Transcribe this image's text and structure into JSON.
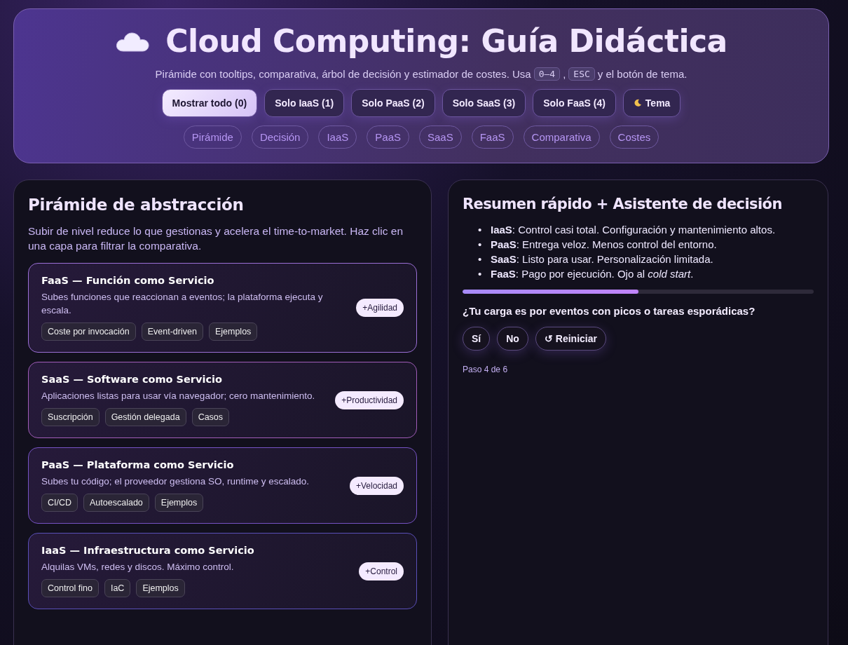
{
  "header": {
    "title": "Cloud Computing: Guía Didáctica",
    "subtitle_before": "Pirámide con tooltips, comparativa, árbol de decisión y estimador de costes. Usa",
    "keys": [
      "0–4",
      "ESC"
    ],
    "key_separator": ",",
    "subtitle_after": "y el botón de tema.",
    "filters": [
      {
        "label": "Mostrar todo (0)",
        "selected": true
      },
      {
        "label": "Solo IaaS (1)",
        "selected": false
      },
      {
        "label": "Solo PaaS (2)",
        "selected": false
      },
      {
        "label": "Solo SaaS (3)",
        "selected": false
      },
      {
        "label": "Solo FaaS (4)",
        "selected": false
      }
    ],
    "theme_button": "Tema",
    "nav": [
      "Pirámide",
      "Decisión",
      "IaaS",
      "PaaS",
      "SaaS",
      "FaaS",
      "Comparativa",
      "Costes"
    ]
  },
  "pyramid": {
    "title": "Pirámide de abstracción",
    "intro": "Subir de nivel reduce lo que gestionas y acelera el time-to-market. Haz clic en una capa para filtrar la comparativa.",
    "layers": [
      {
        "title": "FaaS — Función como Servicio",
        "description": "Subes funciones que reaccionan a eventos; la plataforma ejecuta y escala.",
        "badge": "+Agilidad",
        "tags": [
          "Coste por invocación",
          "Event-driven",
          "Ejemplos"
        ],
        "color": "#9b6fd6"
      },
      {
        "title": "SaaS — Software como Servicio",
        "description": "Aplicaciones listas para usar vía navegador; cero mantenimiento.",
        "badge": "+Productividad",
        "tags": [
          "Suscripción",
          "Gestión delegada",
          "Casos"
        ],
        "color": "#a05cb8"
      },
      {
        "title": "PaaS — Plataforma como Servicio",
        "description": "Subes tu código; el proveedor gestiona SO, runtime y escalado.",
        "badge": "+Velocidad",
        "tags": [
          "CI/CD",
          "Autoescalado",
          "Ejemplos"
        ],
        "color": "#7653c4"
      },
      {
        "title": "IaaS — Infraestructura como Servicio",
        "description": "Alquilas VMs, redes y discos. Máximo control.",
        "badge": "+Control",
        "tags": [
          "Control fino",
          "IaC",
          "Ejemplos"
        ],
        "color": "#5a4fb8"
      }
    ]
  },
  "summary": {
    "title": "Resumen rápido + Asistente de decisión",
    "marker": "•",
    "points": [
      "**IaaS**: Control casi total. Configuración y mantenimiento altos.",
      "**PaaS**: Entrega veloz. Menos control del entorno.",
      "**SaaS**: Listo para usar. Personalización limitada.",
      "**FaaS**: Pago por ejecución. Ojo al *cold start*."
    ],
    "progress": {
      "level": 0.5
    },
    "question": "¿Tu carga es por eventos con picos o tareas esporádicas?",
    "answers": [
      "Sí",
      "No",
      "↺ Reiniciar"
    ],
    "step": "Paso 4 de 6"
  }
}
